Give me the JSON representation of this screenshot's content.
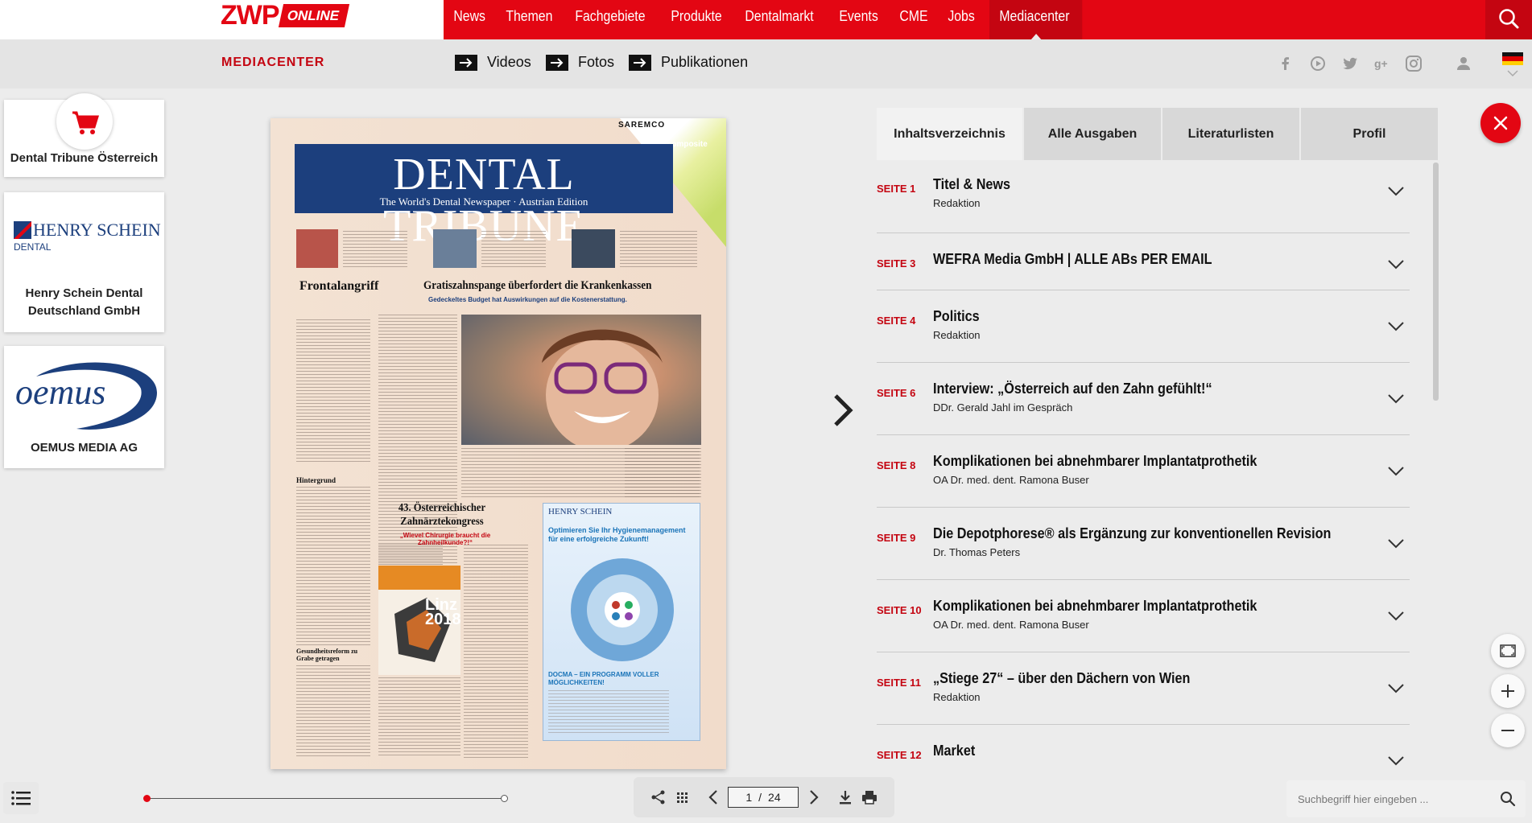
{
  "brand": {
    "logo_main": "ZWP",
    "logo_badge": "ONLINE"
  },
  "nav": {
    "items": [
      "News",
      "Themen",
      "Fachgebiete",
      "Produkte",
      "Dentalmarkt",
      "Events",
      "CME",
      "Jobs",
      "Mediacenter"
    ],
    "active": "Mediacenter"
  },
  "subbar": {
    "title": "MEDIACENTER",
    "links": [
      "Videos",
      "Fotos",
      "Publikationen"
    ],
    "social_icons": [
      "facebook-icon",
      "youtube-icon",
      "twitter-icon",
      "google-plus-icon",
      "instagram-icon",
      "user-icon"
    ]
  },
  "sidebar": {
    "cards": [
      {
        "label": "Dental Tribune Österreich",
        "icon": "cart-icon"
      },
      {
        "label": "Henry Schein Dental Deutschland GmbH",
        "logo_text": "HENRY SCHEIN",
        "logo_sub": "DENTAL"
      },
      {
        "label": "OEMUS MEDIA AG",
        "logo_text": "oemus"
      }
    ]
  },
  "magazine": {
    "masthead": "DENTAL TRIBUNE",
    "tagline": "The World's Dental Newspaper · Austrian Edition",
    "corner_brand": "SAREMCO",
    "corner_product": "apt composite",
    "headline_left": "Frontalangriff",
    "headline_main": "Gratiszahnspange überfordert die Krankenkassen",
    "subheadline_main": "Gedeckeltes Budget hat Auswirkungen auf die Kostenerstattung.",
    "headline_congress": "43. Österreichischer Zahnärztekongress",
    "subheadline_congress": "„Wievel Chirurgie braucht die Zahnheilkunde?!“",
    "section_hintergrund": "Hintergrund",
    "section_gesundheit": "Gesundheitsreform zu Grabe getragen",
    "congress_city": "Linz",
    "congress_year": "2018",
    "ad_brand": "HENRY SCHEIN",
    "ad_headline": "Optimieren Sie Ihr Hygienemanagement für eine erfolgreiche Zukunft!",
    "ad_footer": "DOCMA – EIN PROGRAMM VOLLER MÖGLICHKEITEN!"
  },
  "panel": {
    "tabs": [
      "Inhaltsverzeichnis",
      "Alle Ausgaben",
      "Literaturlisten",
      "Profil"
    ],
    "active_tab": "Inhaltsverzeichnis",
    "toc": [
      {
        "page": "SEITE 1",
        "title": "Titel & News",
        "author": "Redaktion"
      },
      {
        "page": "SEITE 3",
        "title": "WEFRA Media GmbH | ALLE ABs PER EMAIL",
        "author": ""
      },
      {
        "page": "SEITE 4",
        "title": "Politics",
        "author": "Redaktion"
      },
      {
        "page": "SEITE 6",
        "title": "Interview: „Österreich auf den Zahn gefühlt!“",
        "author": "DDr. Gerald Jahl im Gespräch"
      },
      {
        "page": "SEITE 8",
        "title": "Komplikationen bei abnehmbarer Implantatprothetik",
        "author": "OA Dr. med. dent. Ramona Buser"
      },
      {
        "page": "SEITE 9",
        "title": "Die Depotphorese® als Ergänzung zur konventionellen Revision",
        "author": "Dr. Thomas Peters"
      },
      {
        "page": "SEITE 10",
        "title": "Komplikationen bei abnehmbarer Implantatprothetik",
        "author": "OA Dr. med. dent. Ramona Buser"
      },
      {
        "page": "SEITE 11",
        "title": "„Stiege 27“ – über den Dächern von Wien",
        "author": "Redaktion"
      },
      {
        "page": "SEITE 12",
        "title": "Market",
        "author": ""
      }
    ]
  },
  "viewer": {
    "current_page": "1",
    "separator": "/",
    "total_pages": "24",
    "progress": 0.0
  },
  "search": {
    "placeholder": "Suchbegriff hier eingeben ..."
  },
  "colors": {
    "brand_red": "#e30613",
    "dark_red": "#c40511",
    "masthead_blue": "#1c3f7d"
  }
}
